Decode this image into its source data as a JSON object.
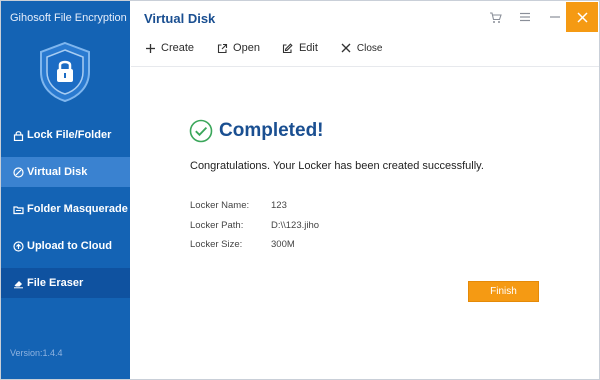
{
  "app": {
    "name": "Gihosoft File Encryption",
    "version": "Version:1.4.4"
  },
  "sidebar": {
    "items": [
      {
        "label": "Lock File/Folder",
        "icon": "lock-icon"
      },
      {
        "label": "Virtual Disk",
        "icon": "disk-icon"
      },
      {
        "label": "Folder Masquerade",
        "icon": "masquerade-icon"
      },
      {
        "label": "Upload to Cloud",
        "icon": "cloud-upload-icon"
      },
      {
        "label": "File Eraser",
        "icon": "eraser-icon"
      }
    ],
    "active_item": "Virtual Disk"
  },
  "header": {
    "title": "Virtual Disk"
  },
  "toolbar": {
    "create_label": "Create",
    "open_label": "Open",
    "edit_label": "Edit",
    "close_label": "Close"
  },
  "content": {
    "completed_title": "Completed!",
    "message": "Congratulations. Your Locker has been created successfully.",
    "details": [
      {
        "label": "Locker Name:",
        "value": "123"
      },
      {
        "label": "Locker Path:",
        "value": "D:\\\\123.jiho"
      },
      {
        "label": "Locker Size:",
        "value": "300M"
      }
    ],
    "finish_label": "Finish"
  },
  "colors": {
    "sidebar_bg": "#1463b4",
    "sidebar_active": "#3a82d0",
    "accent_orange": "#f59a13",
    "title_blue": "#1a4f91",
    "check_green": "#3aa65a"
  }
}
